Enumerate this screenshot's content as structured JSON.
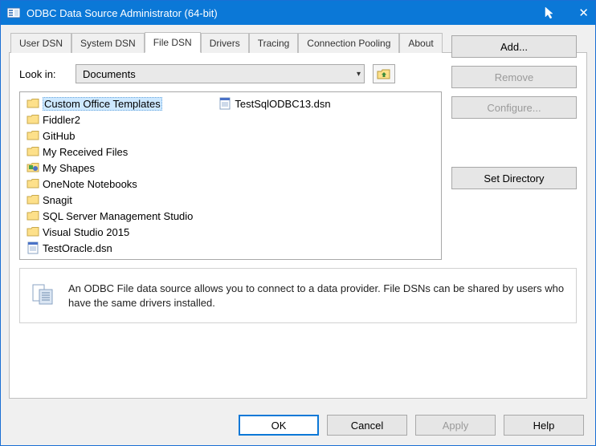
{
  "window": {
    "title": "ODBC Data Source Administrator (64-bit)"
  },
  "tabs": {
    "items": [
      {
        "label": "User DSN"
      },
      {
        "label": "System DSN"
      },
      {
        "label": "File DSN"
      },
      {
        "label": "Drivers"
      },
      {
        "label": "Tracing"
      },
      {
        "label": "Connection Pooling"
      },
      {
        "label": "About"
      }
    ],
    "active_index": 2
  },
  "lookin": {
    "label": "Look in:",
    "value": "Documents"
  },
  "file_list": {
    "items": [
      {
        "name": "Custom Office Templates",
        "type": "folder",
        "selected": true
      },
      {
        "name": "Fiddler2",
        "type": "folder"
      },
      {
        "name": "GitHub",
        "type": "folder"
      },
      {
        "name": "My Received Files",
        "type": "folder"
      },
      {
        "name": "My Shapes",
        "type": "shapes"
      },
      {
        "name": "OneNote Notebooks",
        "type": "folder"
      },
      {
        "name": "Snagit",
        "type": "folder"
      },
      {
        "name": "SQL Server Management Studio",
        "type": "folder"
      },
      {
        "name": "Visual Studio 2015",
        "type": "folder"
      },
      {
        "name": "TestOracle.dsn",
        "type": "dsn"
      },
      {
        "name": "TestSqlODBC13.dsn",
        "type": "dsn"
      }
    ]
  },
  "side_buttons": {
    "add": "Add...",
    "remove": "Remove",
    "configure": "Configure...",
    "set_directory": "Set Directory"
  },
  "info": {
    "text": "An ODBC File data source allows you to connect to a data provider.  File DSNs can be shared by users who have the same drivers installed."
  },
  "buttons": {
    "ok": "OK",
    "cancel": "Cancel",
    "apply": "Apply",
    "help": "Help"
  }
}
